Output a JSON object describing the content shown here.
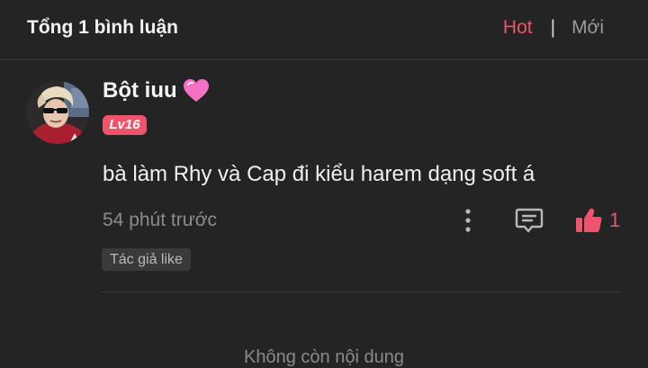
{
  "header": {
    "title": "Tổng 1 bình luận",
    "sort_hot": "Hot",
    "sort_separator": "|",
    "sort_new": "Mới",
    "active_sort": "Hot"
  },
  "comment": {
    "username": "Bột iuu",
    "username_emoji": "pink-heart-icon",
    "level": "Lv16",
    "text": "bà làm Rhy và Cap đi kiểu harem dạng soft á",
    "timestamp": "54 phút trước",
    "like_count": "1",
    "author_like_badge": "Tác giả like"
  },
  "footer": {
    "end_text": "Không còn nội dung"
  },
  "colors": {
    "background": "#242424",
    "accent": "#f0546c",
    "muted_text": "#8c8c8c",
    "divider": "#3b3b3b"
  }
}
